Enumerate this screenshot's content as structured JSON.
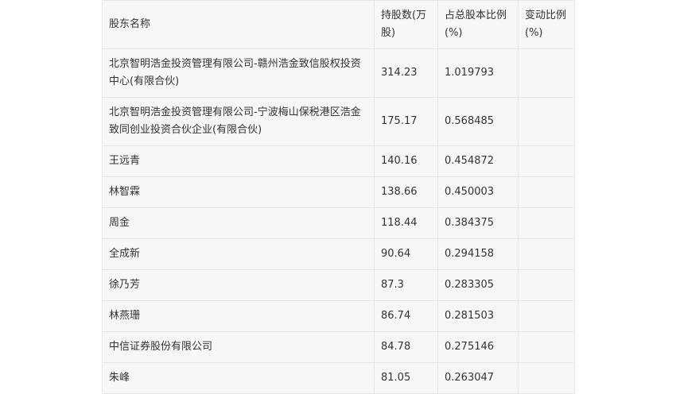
{
  "table": {
    "headers": [
      "股东名称",
      "持股数(万股)",
      "占总股本比例(%)",
      "变动比例(%)"
    ],
    "rows": [
      {
        "name": "北京智明浩金投资管理有限公司-赣州浩金致信股权投资中心(有限合伙)",
        "shares": "314.23",
        "ratio": "1.019793",
        "change": ""
      },
      {
        "name": "北京智明浩金投资管理有限公司-宁波梅山保税港区浩金致同创业投资合伙企业(有限合伙)",
        "shares": "175.17",
        "ratio": "0.568485",
        "change": ""
      },
      {
        "name": "王远青",
        "shares": "140.16",
        "ratio": "0.454872",
        "change": ""
      },
      {
        "name": "林智霖",
        "shares": "138.66",
        "ratio": "0.450003",
        "change": ""
      },
      {
        "name": "周金",
        "shares": "118.44",
        "ratio": "0.384375",
        "change": ""
      },
      {
        "name": "全成新",
        "shares": "90.64",
        "ratio": "0.294158",
        "change": ""
      },
      {
        "name": "徐乃芳",
        "shares": "87.3",
        "ratio": "0.283305",
        "change": ""
      },
      {
        "name": "林燕珊",
        "shares": "86.74",
        "ratio": "0.281503",
        "change": ""
      },
      {
        "name": "中信证券股份有限公司",
        "shares": "84.78",
        "ratio": "0.275146",
        "change": ""
      },
      {
        "name": "朱峰",
        "shares": "81.05",
        "ratio": "0.263047",
        "change": ""
      }
    ]
  }
}
